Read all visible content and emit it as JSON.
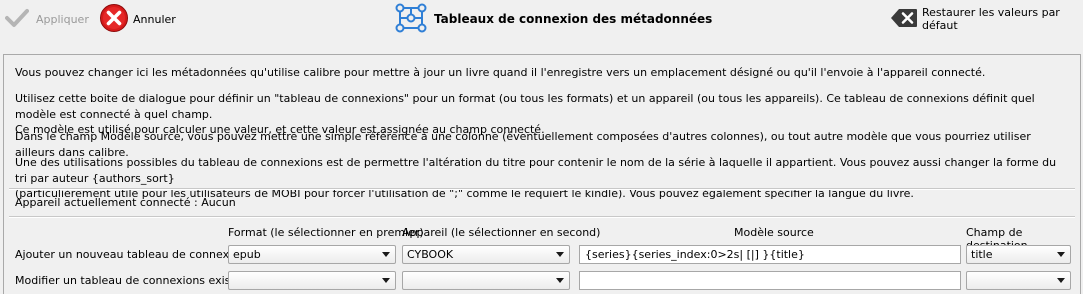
{
  "toolbar": {
    "apply_label": "Appliquer",
    "cancel_label": "Annuler",
    "title": "Tableaux de connexion des métadonnées",
    "restore_label": "Restaurer les valeurs par défaut"
  },
  "description": {
    "p1": "Vous pouvez changer ici les métadonnées qu'utilise calibre pour mettre à jour un livre quand il l'enregistre vers un emplacement désigné ou qu'il l'envoie à l'appareil connecté.",
    "p2_line1": "Utilisez cette boite de dialogue pour définir un \"tableau de connexions\" pour un format (ou tous les formats) et un appareil (ou tous les appareils). Ce tableau de connexions définit quel modèle est connecté à quel champ.",
    "p2_line2": "Ce modèle est utilisé pour calculer une valeur, et cette valeur est assignée au champ connecté.",
    "p3": "Dans le champ Modèle source, vous pouvez mettre une simple référence à une colonne (éventuellement composées d'autres colonnes), ou tout autre modèle que vous pourriez utiliser ailleurs dans calibre.",
    "p4_line1": "Une des utilisations possibles du tableau de connexions est de permettre l'altération du titre pour contenir le nom de la série à laquelle il appartient. Vous pouvez aussi changer la forme du tri par auteur {authors_sort}",
    "p4_line2": "(particulièrement utile pour les utilisateurs de MOBI pour forcer l'utilisation de \";\" comme le requiert le kindle). Vous pouvez également spécifier la langue du livre."
  },
  "connected_device": "Appareil actuellement connecté : Aucun",
  "columns": {
    "format": "Format (le sélectionner en premier)",
    "device": "Appareil (le sélectionner en second)",
    "template": "Modèle source",
    "destination": "Champ de destination"
  },
  "rows": {
    "add": {
      "label": "Ajouter un nouveau tableau de connexions",
      "format": "epub",
      "device": "CYBOOK",
      "template": "{series}{series_index:0>2s| [|] }{title}",
      "destination": "title"
    },
    "modify": {
      "label": "Modifier un tableau de connexions existant",
      "format": "",
      "device": "",
      "template": "",
      "destination": ""
    }
  },
  "icons": {
    "apply": "checkmark-icon",
    "cancel": "cancel-x-icon",
    "title": "plugboard-icon",
    "restore": "clear-left-icon"
  }
}
